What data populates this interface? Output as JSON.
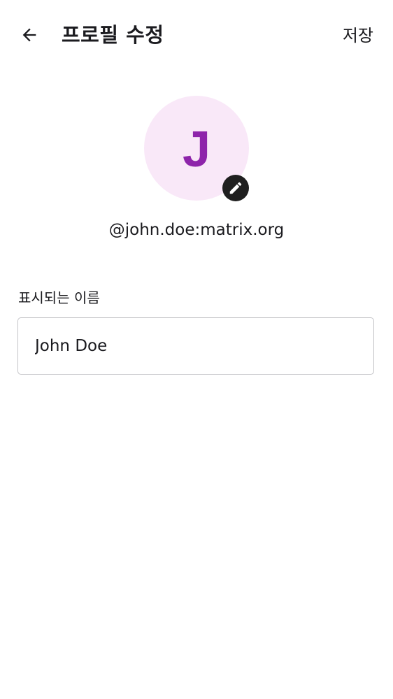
{
  "header": {
    "back_icon": "arrow-back-icon",
    "title": "프로필 수정",
    "save_label": "저장"
  },
  "profile": {
    "avatar_letter": "J",
    "avatar_bg_color": "#f9e8f8",
    "avatar_letter_color": "#8e24aa",
    "edit_icon": "pencil-icon",
    "user_id": "@john.doe:matrix.org"
  },
  "display_name_field": {
    "label": "표시되는 이름",
    "value": "John Doe"
  }
}
